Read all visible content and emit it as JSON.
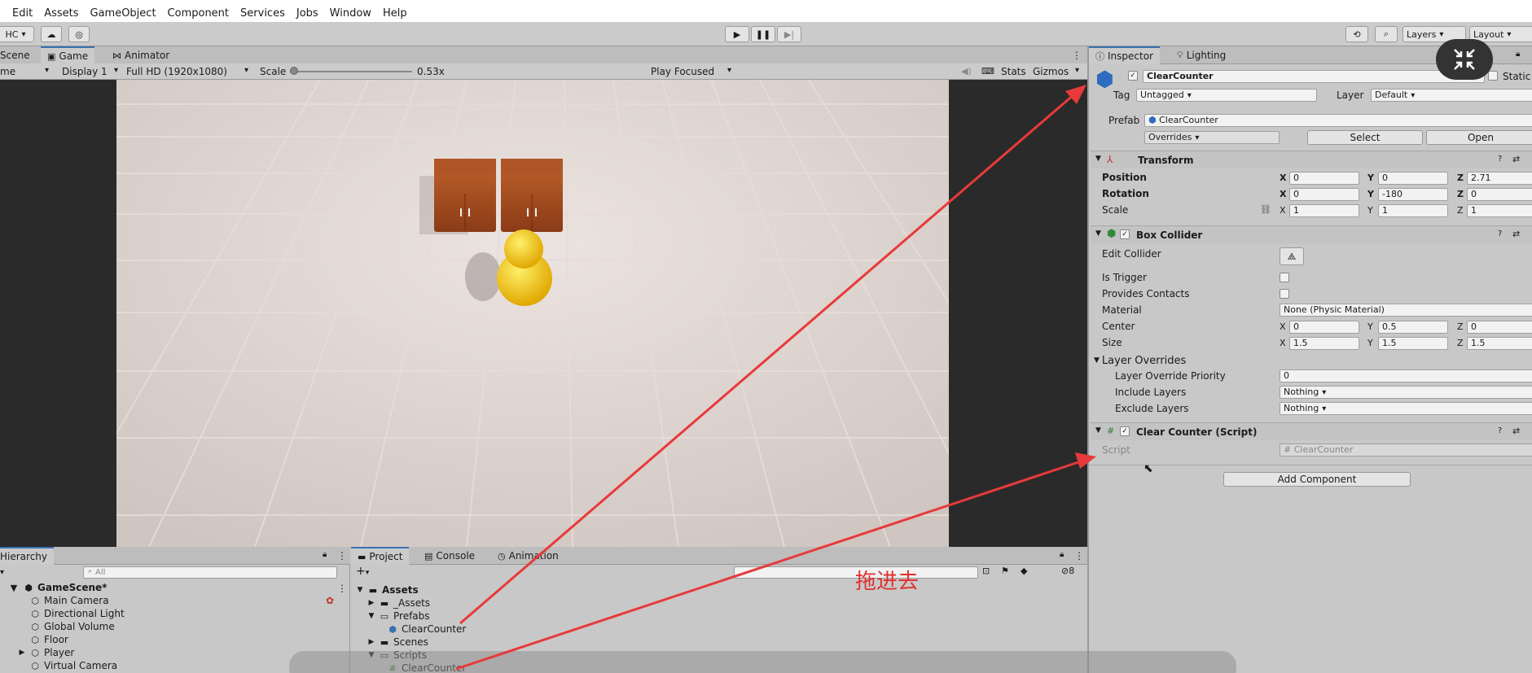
{
  "menu": [
    "Edit",
    "Assets",
    "GameObject",
    "Component",
    "Services",
    "Jobs",
    "Window",
    "Help"
  ],
  "toolbar": {
    "account": "HC",
    "layers": "Layers",
    "layout": "Layout"
  },
  "scene_tabs": {
    "scene": "Scene",
    "game": "Game",
    "animator": "Animator"
  },
  "gamebar": {
    "mode": "me",
    "display": "Display 1",
    "resolution": "Full HD (1920x1080)",
    "scale_label": "Scale",
    "scale_value": "0.53x",
    "play_focus": "Play Focused",
    "stats": "Stats",
    "gizmos": "Gizmos"
  },
  "hierarchy": {
    "tab": "Hierarchy",
    "search_placeholder": "All",
    "scene": "GameScene*",
    "items": [
      "Main Camera",
      "Directional Light",
      "Global Volume",
      "Floor",
      "Player",
      "Virtual Camera"
    ]
  },
  "project": {
    "tabs": [
      "Project",
      "Console",
      "Animation"
    ],
    "hidden_count": "8",
    "tree": {
      "root": "Assets",
      "assets_sub": "_Assets",
      "prefabs": "Prefabs",
      "prefab_item": "ClearCounter",
      "scenes": "Scenes",
      "scripts": "Scripts",
      "script_item": "ClearCounter"
    }
  },
  "inspector": {
    "tabs": [
      "Inspector",
      "Lighting"
    ],
    "object_name": "ClearCounter",
    "static_label": "Static",
    "tag_label": "Tag",
    "tag_value": "Untagged",
    "layer_label": "Layer",
    "layer_value": "Default",
    "prefab_label": "Prefab",
    "prefab_value": "ClearCounter",
    "overrides": "Overrides",
    "select": "Select",
    "open": "Open",
    "transform": {
      "title": "Transform",
      "position_label": "Position",
      "rotation_label": "Rotation",
      "scale_label": "Scale",
      "position": [
        "0",
        "0",
        "2.71"
      ],
      "rotation": [
        "0",
        "-180",
        "0"
      ],
      "scale": [
        "1",
        "1",
        "1"
      ]
    },
    "box_collider": {
      "title": "Box Collider",
      "edit_collider": "Edit Collider",
      "is_trigger": "Is Trigger",
      "provides_contacts": "Provides Contacts",
      "material_label": "Material",
      "material_value": "None (Physic Material)",
      "center_label": "Center",
      "center": [
        "0",
        "0.5",
        "0"
      ],
      "size_label": "Size",
      "size": [
        "1.5",
        "1.5",
        "1.5"
      ],
      "layer_overrides": "Layer Overrides",
      "priority_label": "Layer Override Priority",
      "priority_value": "0",
      "include_label": "Include Layers",
      "include_value": "Nothing",
      "exclude_label": "Exclude Layers",
      "exclude_value": "Nothing"
    },
    "script_comp": {
      "title": "Clear Counter (Script)",
      "script_label": "Script",
      "script_value": "ClearCounter"
    },
    "add_component": "Add Component"
  },
  "axis_letters": {
    "x": "X",
    "y": "Y",
    "z": "Z"
  },
  "annotation": "拖进去",
  "colors": {
    "arrow": "#e83a3a",
    "accent": "#3a72b0"
  }
}
